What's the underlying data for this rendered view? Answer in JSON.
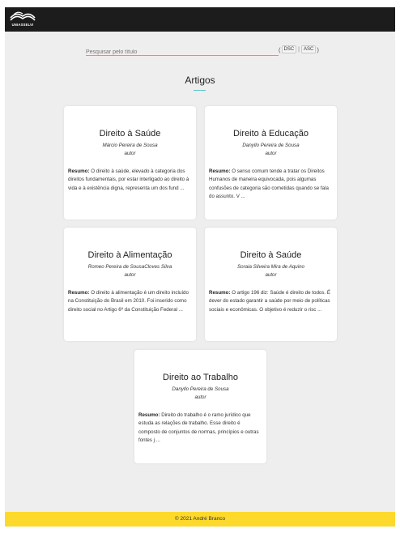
{
  "header": {
    "logo_text": "UNIASSELVI"
  },
  "search": {
    "placeholder": "Pesquisar pelo título",
    "value": ""
  },
  "sort": {
    "desc_label": "DSC",
    "asc_label": "ASC",
    "open_paren": "(",
    "separator": "|",
    "close_paren": ")"
  },
  "page": {
    "heading": "Artigos"
  },
  "articles": [
    {
      "title": "Direito à Saúde",
      "author": "Márcio Pereira de Sousa",
      "role": "autor",
      "summary_label": "Resumo:",
      "summary": "O direito à saúde, elevado à categoria dos direitos fundamentais, por estar interligado ao direito à vida e à existência digna, representa um dos fund ..."
    },
    {
      "title": "Direito à Educação",
      "author": "Danyllo Pereira de Sousa",
      "role": "autor",
      "summary_label": "Resumo:",
      "summary": "O senso comum tende a tratar os Direitos Humanos de maneira equivocada, pois algumas confusões de categoria são cometidas quando se fala do assunto. V ..."
    },
    {
      "title": "Direito à Alimentação",
      "author": "Romeo Pereira de SousaCloves Silva",
      "role": "autor",
      "summary_label": "Resumo:",
      "summary": "O direito à alimentação é um direito incluído na Constituição do Brasil em 2010. Foi inserido como direito social no Artigo 6º da Constituição Federal ..."
    },
    {
      "title": "Direito à Saúde",
      "author": "Soraia Silveira Mira de Aquino",
      "role": "autor",
      "summary_label": "Resumo:",
      "summary": "O artigo 196 diz: Saúde é direito de todos. É dever do estado garantir a saúde por meio de políticas sociais e econômicas. O objetivo é reduzir o risc ..."
    },
    {
      "title": "Direito ao Trabalho",
      "author": "Danyllo Pereira de Sousa",
      "role": "autor",
      "summary_label": "Resumo:",
      "summary": "Direito do trabalho é o ramo jurídico que estuda as relações de trabalho. Esse direito é composto de conjuntos de normas, princípios e outras fontes j ..."
    }
  ],
  "footer": {
    "text": "© 2021 André Branco"
  },
  "colors": {
    "topbar": "#1c1c1c",
    "background": "#eeeeee",
    "accent": "#5ec3c9",
    "footer": "#fdd92b"
  },
  "icons": {
    "logo": "book-logo-icon"
  }
}
